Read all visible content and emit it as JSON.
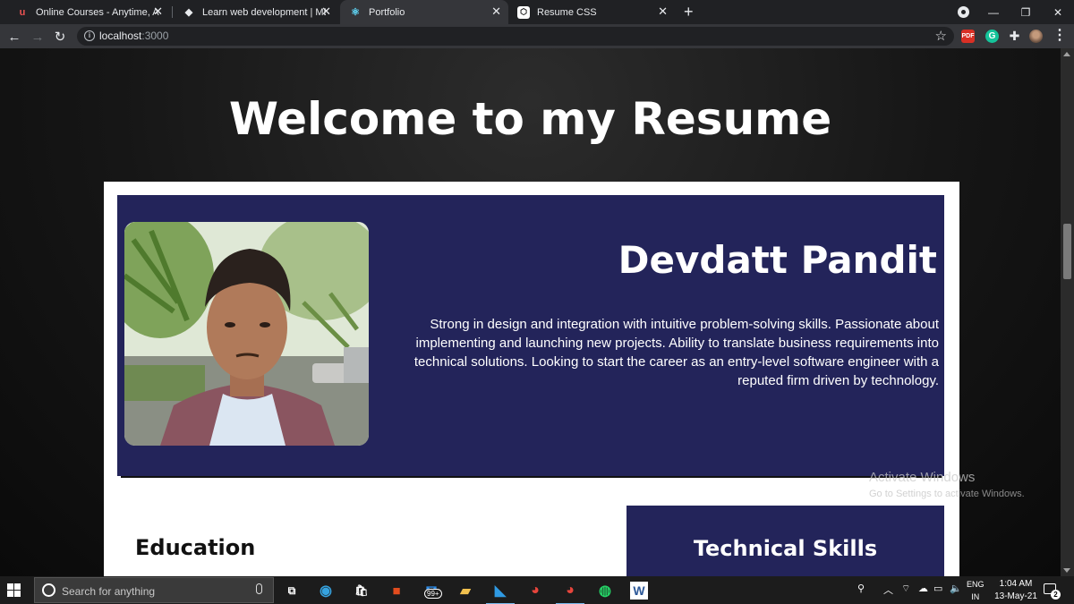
{
  "browser": {
    "tabs": [
      {
        "title": "Online Courses - Anytime, Anywhere",
        "favicon": "udemy-icon"
      },
      {
        "title": "Learn web development | MDN",
        "favicon": "mdn-icon"
      },
      {
        "title": "Portfolio",
        "favicon": "react-icon",
        "active": true
      },
      {
        "title": "Resume CSS",
        "favicon": "codepen-icon"
      }
    ],
    "address": {
      "host": "localhost",
      "port": ":3000"
    },
    "extensions": {
      "pdf_label": "PDF",
      "grammarly_label": "G"
    }
  },
  "page": {
    "heading": "Welcome to my Resume",
    "resume": {
      "name": "Devdatt Pandit",
      "summary": "Strong in design and integration with intuitive problem-solving skills. Passionate about implementing and launching new projects. Ability to translate business requirements into technical solutions. Looking to start the career as an entry-level software engineer with a reputed firm driven by technology.",
      "education_title": "Education",
      "skills_title": "Technical Skills"
    },
    "colors": {
      "panel": "#23245a",
      "page_bg": "#161616"
    }
  },
  "watermark": {
    "title": "Activate Windows",
    "subtitle": "Go to Settings to activate Windows."
  },
  "taskbar": {
    "search_placeholder": "Search for anything",
    "mail_badge": "99+",
    "language": {
      "line1": "ENG",
      "line2": "IN"
    },
    "clock": {
      "time": "1:04 AM",
      "date": "13-May-21"
    },
    "notification_count": "2"
  }
}
